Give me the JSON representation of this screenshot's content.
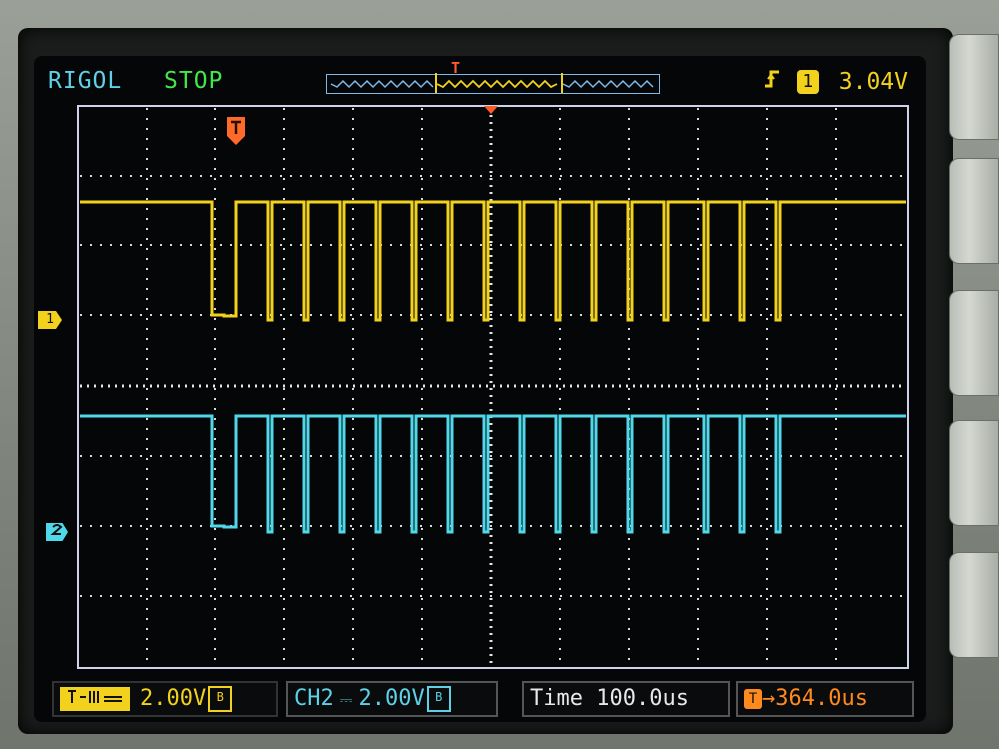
{
  "header": {
    "brand": "RIGOL",
    "run_state": "STOP",
    "trigger_edge_icon": "rising-edge-icon",
    "trigger_source": "1",
    "trigger_level": "3.04V"
  },
  "channels": {
    "ch1": {
      "marker": "1",
      "scale": "2.00V",
      "color": "#f2d21c"
    },
    "ch2": {
      "label": "CH2",
      "scale": "2.00V",
      "color": "#4fd8ea"
    }
  },
  "timebase": {
    "label": "Time",
    "value": "100.0us"
  },
  "trigger_offset": {
    "value": "364.0us",
    "color": "#ff8a1e"
  },
  "trigger_marker": "T",
  "colors": {
    "background": "#050608",
    "grid": "#d8d8d8",
    "accent_text": "#5fd0e6",
    "run_state": "#43e74a"
  }
}
